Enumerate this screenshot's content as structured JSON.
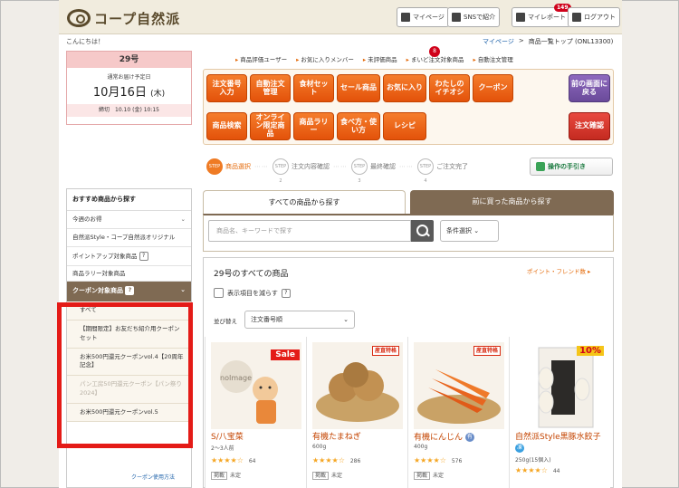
{
  "header": {
    "logo_text": "コープ自然派",
    "mypage": "マイページ",
    "sns": "SNSで紹介",
    "mylabel": "マイレポート",
    "badge": "149",
    "logout": "ログアウト"
  },
  "greeting": "こんにちは！",
  "breadcrumb": {
    "link": "マイページ",
    "sep": ">",
    "current": "商品一覧トップ (ONL13300)"
  },
  "delivery": {
    "number": "29号",
    "sub": "通常お届け予定日",
    "date": "10月16日",
    "weekday": "(木)",
    "deadline": "締切　10.10 (金) 10:15"
  },
  "top_links": [
    "商品評価ユーザー",
    "お気に入りメンバー",
    "未評価商品",
    "まいど注文対象商品",
    "自動注文管理"
  ],
  "top_badge": "8",
  "nav_buttons_row1": [
    "注文番号入力",
    "自動注文管理",
    "食材セット",
    "セール商品",
    "お気に入り",
    "わたしのイチオシ",
    "クーポン"
  ],
  "nav_back": "前の画面に戻る",
  "nav_buttons_row2": [
    "商品検索",
    "オンライン限定商品",
    "商品ラリー",
    "食べ方・使い方",
    "レシピ"
  ],
  "nav_confirm": "注文確認",
  "steps": [
    {
      "num": "STEP 1",
      "label": "商品選択"
    },
    {
      "num": "STEP 2",
      "label": "注文内容確認"
    },
    {
      "num": "STEP 3",
      "label": "最終確認"
    },
    {
      "num": "STEP 4",
      "label": "ご注文完了"
    }
  ],
  "guide_button": "操作の手引き",
  "sidebar": {
    "heading": "おすすめ商品から探す",
    "items": [
      "今週のお得",
      "自然派Style・コープ自然派オリジナル",
      "ポイントアップ対象商品",
      "商品ラリー対象商品"
    ],
    "coupon_head": "クーポン対象商品",
    "coupon_items": [
      "すべて",
      "【期間限定】お友だち紹介用クーポンセット",
      "お米500円還元クーポンvol.4【20周年記念】",
      "パン工房50円還元クーポン【パン祭り2024】",
      "お米500円還元クーポンvol.5"
    ],
    "coupon_link": "クーポン使用方法"
  },
  "tabs": {
    "all": "すべての商品から探す",
    "history": "前に買った商品から探す"
  },
  "search": {
    "placeholder": "商品名、キーワードで探す",
    "condition": "条件選択"
  },
  "results": {
    "title": "29号のすべての商品",
    "point_link": "ポイント・フレンド数",
    "reduce": "表示項目を減らす",
    "sort_label": "並び替え",
    "sort_value": "注文番号順"
  },
  "products": [
    {
      "name": "S/八宝菜",
      "size": "2～3人前",
      "rating": "★★★★☆",
      "count": "64",
      "tag1": "掲載",
      "tag2": "未定",
      "flag": "Sale",
      "img": "noImage"
    },
    {
      "name": "有機たまねぎ",
      "size": "600g",
      "rating": "★★★★☆",
      "count": "286",
      "tag1": "掲載",
      "tag2": "未定",
      "flag": "産直特格",
      "img": "onion"
    },
    {
      "name": "有機にんじん",
      "size": "400g",
      "rating": "★★★★☆",
      "count": "576",
      "tag1": "掲載",
      "tag2": "未定",
      "flag": "産直特格",
      "img": "carrot"
    },
    {
      "name": "自然派Style黒豚水餃子",
      "size": "250g(15個入)",
      "rating": "★★★★☆",
      "count": "44",
      "tag1": "掲載",
      "tag2": "未定",
      "flag": "10%",
      "img": "gyoza"
    }
  ],
  "colors": {
    "accent": "#ef7b24",
    "brown": "#7f6a53",
    "highlight": "#e41b17"
  }
}
